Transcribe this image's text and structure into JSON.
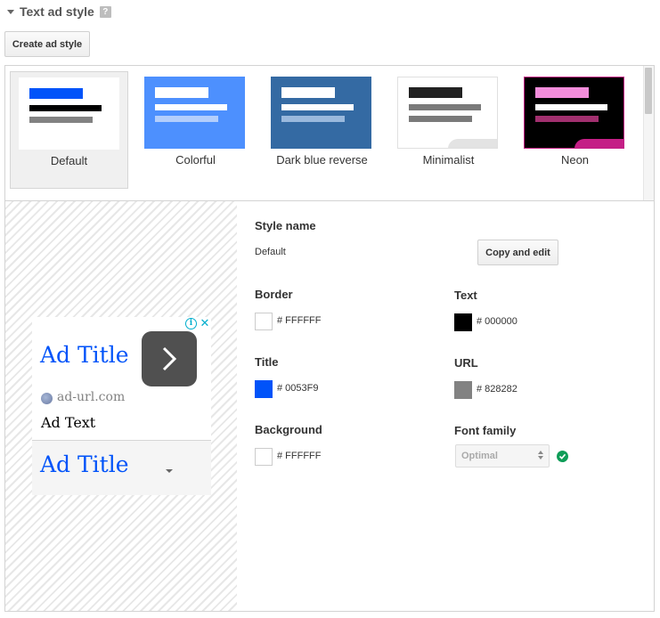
{
  "section": {
    "title": "Text ad style",
    "help_icon": "?"
  },
  "toolbar": {
    "create_label": "Create ad style"
  },
  "styles": [
    {
      "label": "Default",
      "selected": true,
      "bg": "#ffffff",
      "title_color": "#0053f9",
      "text_color": "#000000",
      "url_color": "#828282"
    },
    {
      "label": "Colorful",
      "selected": false,
      "bg": "#4d90fe",
      "title_color": "#ffffff",
      "text_color": "#ffffff",
      "url_color": "#b3cefc"
    },
    {
      "label": "Dark blue reverse",
      "selected": false,
      "bg": "#346aa3",
      "title_color": "#ffffff",
      "text_color": "#ffffff",
      "url_color": "#9ab9dd"
    },
    {
      "label": "Minimalist",
      "selected": false,
      "bg": "#ffffff",
      "title_color": "#222222",
      "text_color": "#7a7a7a",
      "url_color": "#7a7a7a"
    },
    {
      "label": "Neon",
      "selected": false,
      "bg": "#000000",
      "title_color": "#f38ddb",
      "text_color": "#ffffff",
      "url_color": "#a2306f"
    }
  ],
  "preview": {
    "ad_title": "Ad Title",
    "ad_url": "ad-url.com",
    "ad_text": "Ad Text",
    "ad_title_2": "Ad Title",
    "adchoices_info": "i",
    "adchoices_close": "✕"
  },
  "properties": {
    "style_name_label": "Style name",
    "style_name_value": "Default",
    "copy_edit_label": "Copy and edit",
    "border_label": "Border",
    "border_value": "# FFFFFF",
    "border_color": "#ffffff",
    "text_label": "Text",
    "text_value": "# 000000",
    "text_color": "#000000",
    "title_label": "Title",
    "title_value": "# 0053F9",
    "title_color": "#0053f9",
    "url_label": "URL",
    "url_value": "# 828282",
    "url_color": "#828282",
    "background_label": "Background",
    "background_value": "# FFFFFF",
    "background_color": "#ffffff",
    "font_family_label": "Font family",
    "font_family_value": "Optimal"
  }
}
